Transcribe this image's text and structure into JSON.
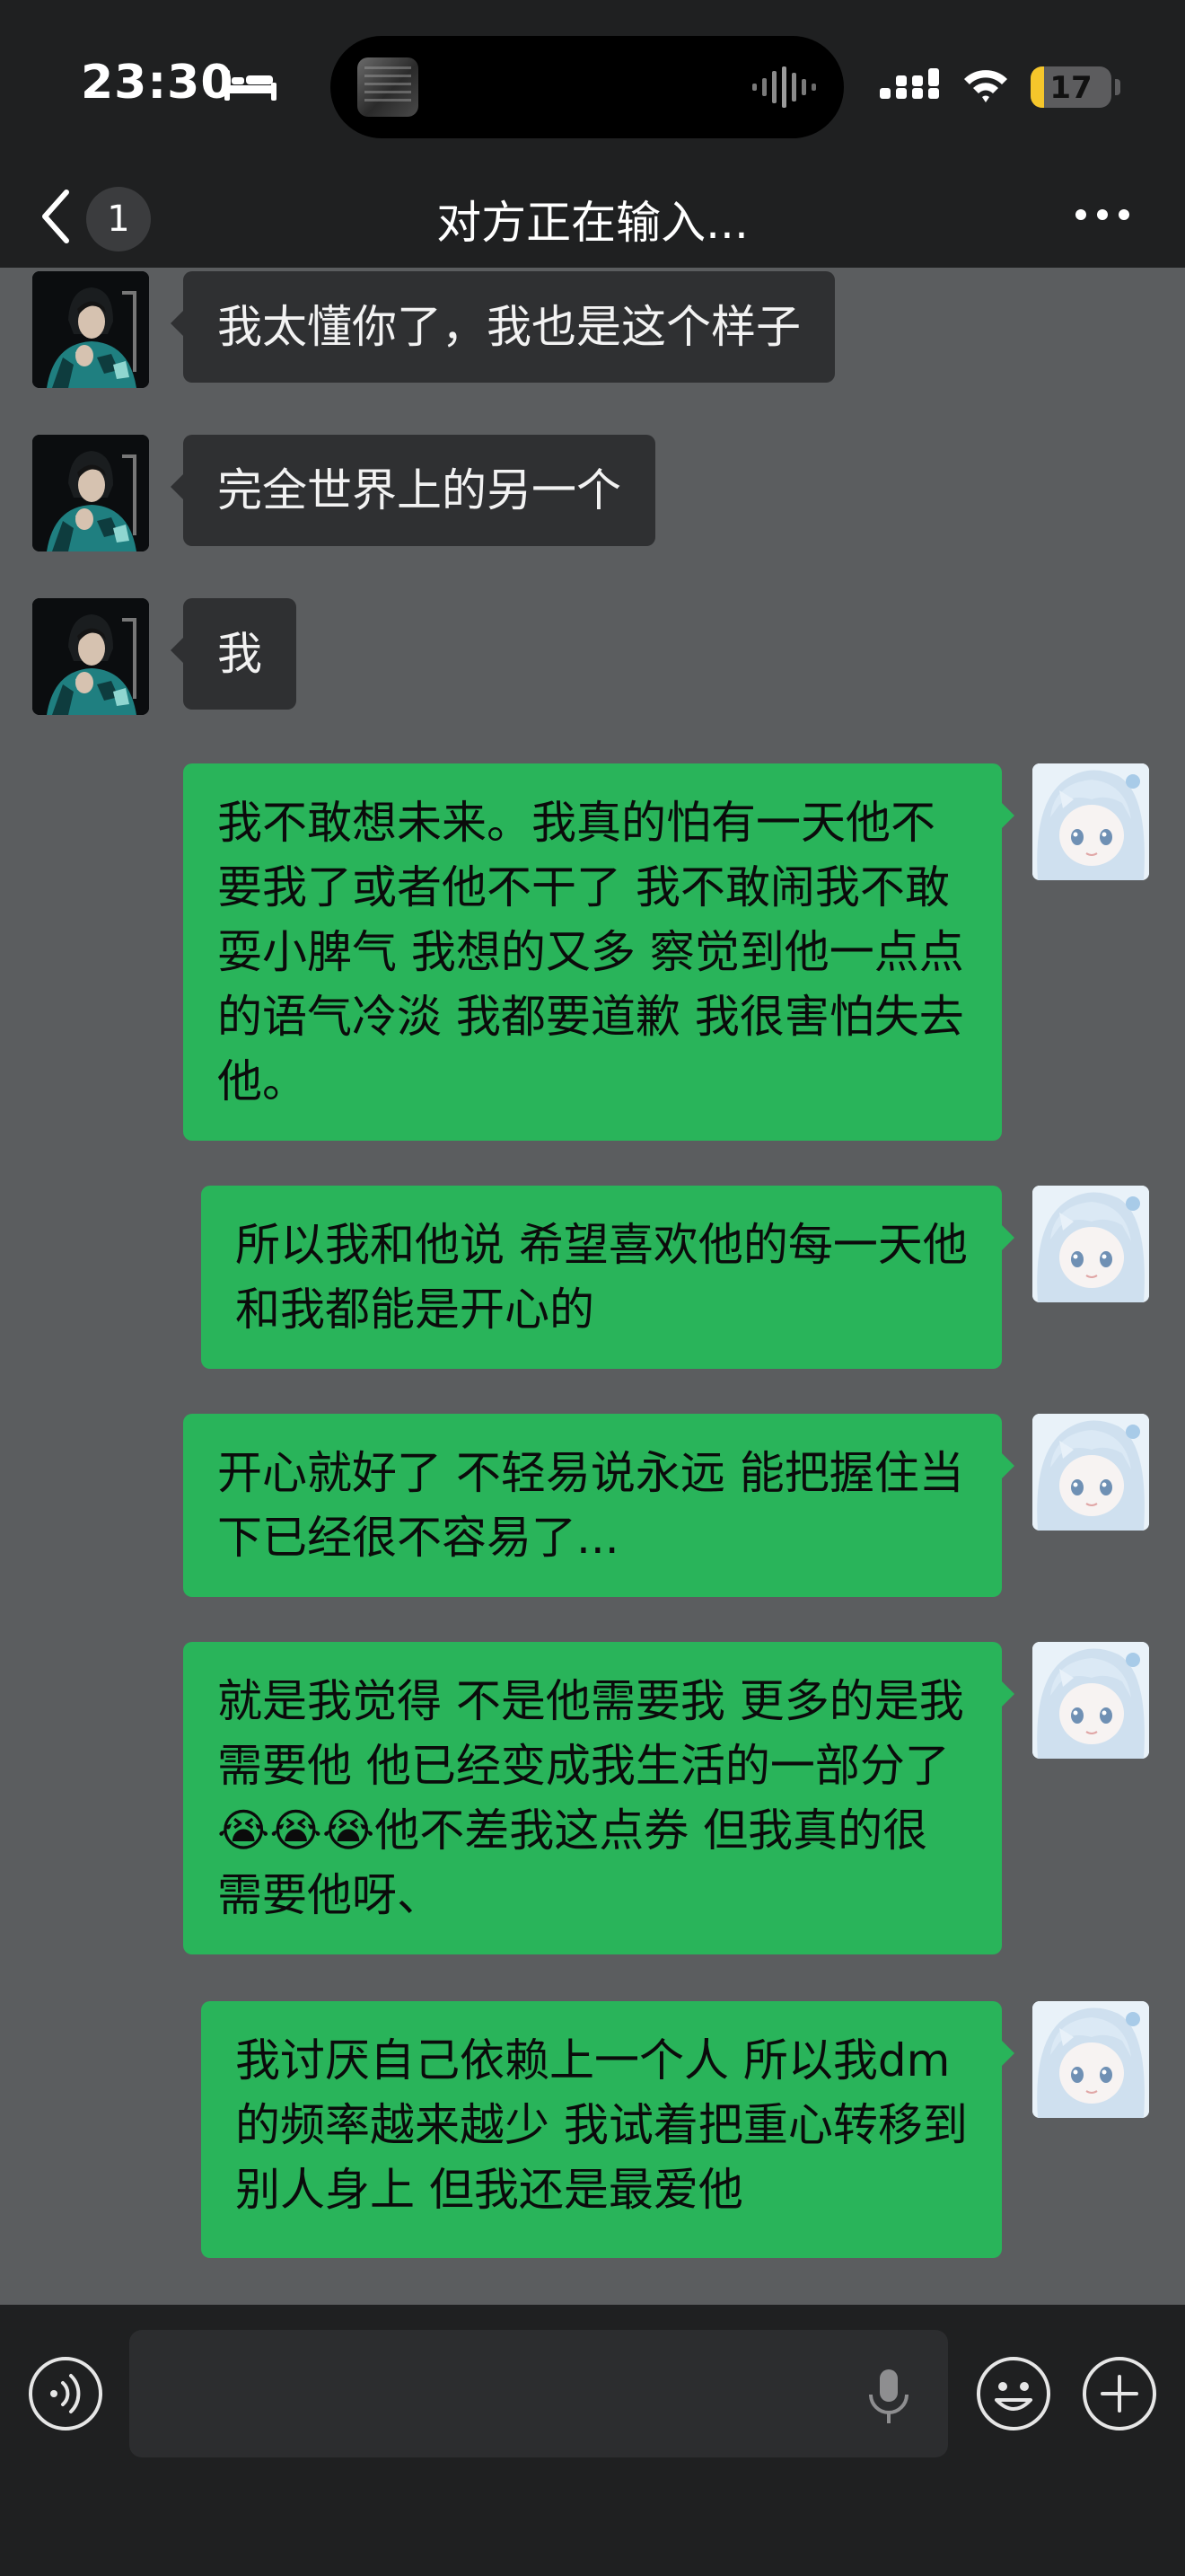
{
  "status_bar": {
    "time": "23:30",
    "battery_level": "17",
    "icons": [
      "bed-icon",
      "now-playing-artwork",
      "waveform-icon",
      "signal-icon",
      "wifi-icon",
      "battery-icon"
    ]
  },
  "nav": {
    "back_icon": "chevron-left-icon",
    "unread_count": "1",
    "title": "对方正在输入...",
    "more_icon": "more-dots-icon"
  },
  "messages": [
    {
      "sender": "peer",
      "text": "我太懂你了，我也是这个样子"
    },
    {
      "sender": "peer",
      "text": "完全世界上的另一个"
    },
    {
      "sender": "peer",
      "text": "我"
    },
    {
      "sender": "me",
      "text": "我不敢想未来。我真的怕有一天他不要我了或者他不干了 我不敢闹我不敢耍小脾气 我想的又多 察觉到他一点点的语气冷淡 我都要道歉 我很害怕失去他。"
    },
    {
      "sender": "me",
      "text": "所以我和他说 希望喜欢他的每一天他和我都能是开心的"
    },
    {
      "sender": "me",
      "text": "开心就好了 不轻易说永远 能把握住当下已经很不容易了..."
    },
    {
      "sender": "me",
      "text": "就是我觉得 不是他需要我 更多的是我需要他 他已经变成我生活的一部分了😭😭😭他不差我这点券 但我真的很需要他呀、"
    },
    {
      "sender": "me",
      "text": "我讨厌自己依赖上一个人 所以我dm的频率越来越少 我试着把重心转移到别人身上 但我还是最爱他"
    }
  ],
  "input_bar": {
    "message_value": "",
    "icons": [
      "voice-mode-icon",
      "microphone-icon",
      "emoji-icon",
      "plus-icon"
    ]
  },
  "colors": {
    "chat_background": "#5b5d5f",
    "bars": "#1f2021",
    "peer_bubble": "#2f3032",
    "my_bubble": "#29b45a",
    "battery_fill": "#f5c62b"
  }
}
